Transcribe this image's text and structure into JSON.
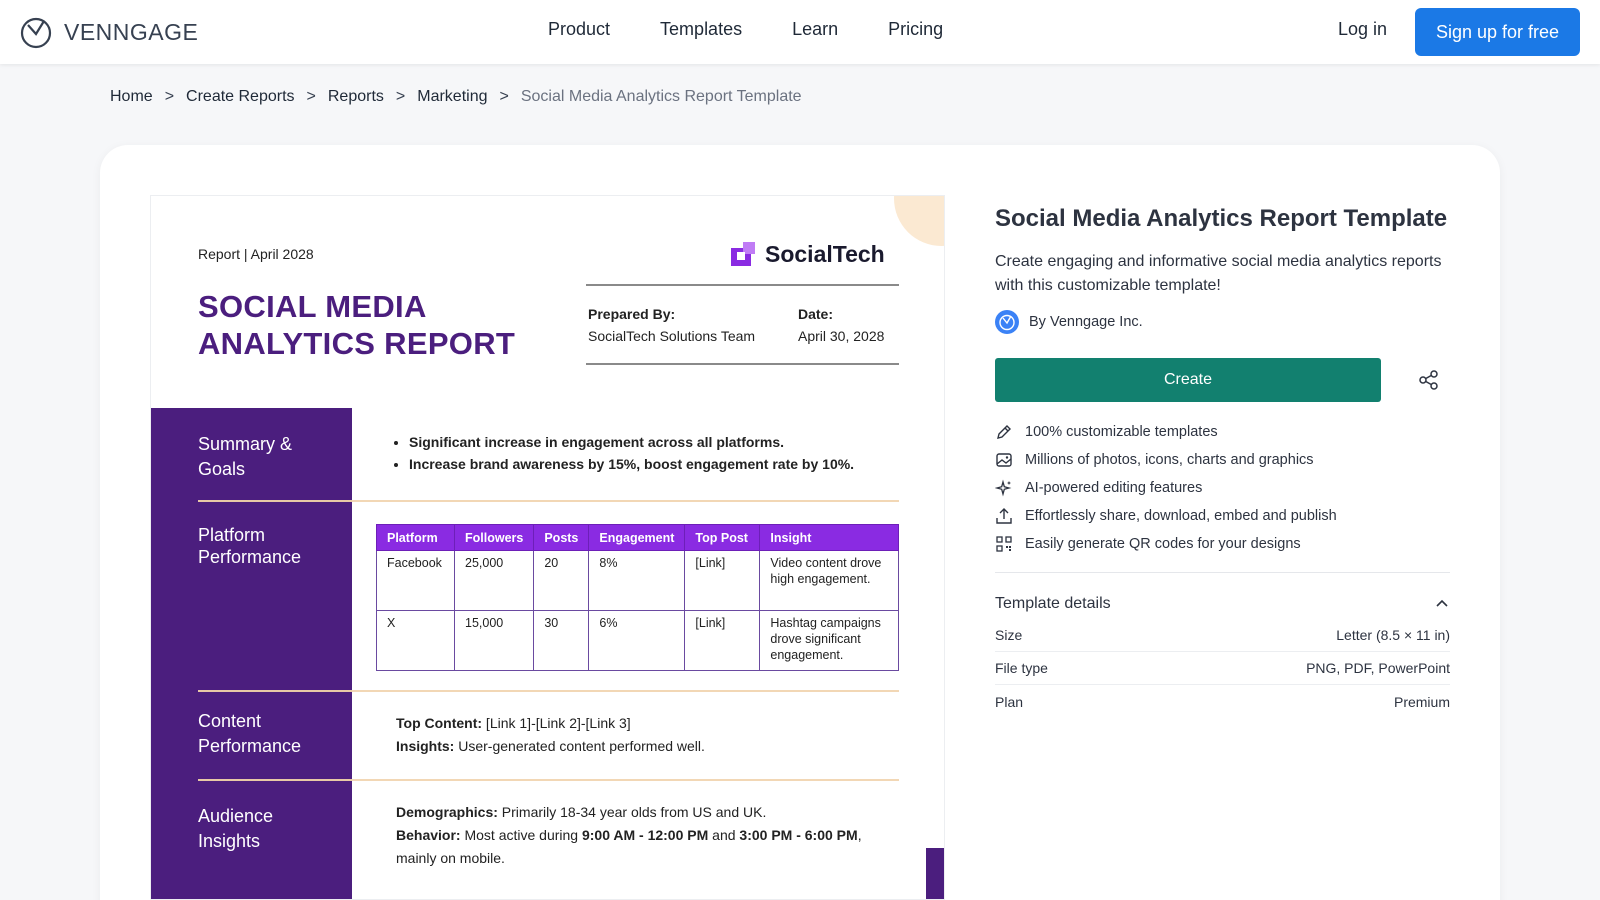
{
  "header": {
    "brand": "VENNGAGE",
    "nav": [
      "Product",
      "Templates",
      "Learn",
      "Pricing"
    ],
    "login": "Log in",
    "signup": "Sign up for free"
  },
  "breadcrumb": [
    "Home",
    "Create Reports",
    "Reports",
    "Marketing"
  ],
  "breadcrumb_sep": ">",
  "breadcrumb_current": "Social Media Analytics Report Template",
  "preview": {
    "topline": "Report | April 2028",
    "brand": "SocialTech",
    "title_line1": "SOCIAL MEDIA",
    "title_line2": "ANALYTICS REPORT",
    "prepared_label": "Prepared By:",
    "prepared_value": "SocialTech Solutions Team",
    "date_label": "Date:",
    "date_value": "April 30, 2028",
    "side": {
      "summary_l1": "Summary &",
      "summary_l2": "Goals",
      "platform_l1": "Platform",
      "platform_l2": "Performance",
      "content_l1": "Content",
      "content_l2": "Performance",
      "audience_l1": "Audience",
      "audience_l2": "Insights"
    },
    "bullets": [
      "Significant increase in engagement across all platforms.",
      "Increase brand awareness by 15%, boost engagement rate by 10%."
    ],
    "table": {
      "headers": [
        "Platform",
        "Followers",
        "Posts",
        "Engagement",
        "Top Post",
        "Insight"
      ],
      "rows": [
        [
          "Facebook",
          "25,000",
          "20",
          "8%",
          "[Link]",
          "Video content drove high engagement."
        ],
        [
          "X",
          "15,000",
          "30",
          "6%",
          "[Link]",
          "Hashtag campaigns drove significant engagement."
        ]
      ]
    },
    "content": {
      "top_label": "Top Content:",
      "top_value": " [Link 1]-[Link 2]-[Link 3]",
      "insights_label": "Insights:",
      "insights_value": " User-generated content performed well."
    },
    "audience": {
      "demo_label": "Demographics:",
      "demo_value": " Primarily 18-34 year olds from US and UK.",
      "behavior_label": "Behavior:",
      "behavior_pre": " Most active during ",
      "behavior_time1": "9:00 AM - 12:00 PM",
      "behavior_and": " and ",
      "behavior_time2": "3:00 PM - 6:00 PM",
      "behavior_post": ", mainly on mobile."
    }
  },
  "info": {
    "title": "Social Media Analytics Report Template",
    "description": "Create engaging and informative social media analytics reports with this customizable template!",
    "author": "By Venngage Inc.",
    "create": "Create",
    "features": [
      {
        "icon": "pencil-icon",
        "text": "100% customizable templates"
      },
      {
        "icon": "image-icon",
        "text": "Millions of photos, icons, charts and graphics"
      },
      {
        "icon": "sparkles-icon",
        "text": "AI-powered editing features"
      },
      {
        "icon": "upload-icon",
        "text": "Effortlessly share, download, embed and publish"
      },
      {
        "icon": "qr-code-icon",
        "text": "Easily generate QR codes for your designs"
      }
    ],
    "details_title": "Template details",
    "details": [
      {
        "label": "Size",
        "value": "Letter (8.5 × 11 in)"
      },
      {
        "label": "File type",
        "value": "PNG, PDF, PowerPoint"
      },
      {
        "label": "Plan",
        "value": "Premium"
      }
    ]
  },
  "colors": {
    "primary_blue": "#1b79e6",
    "create_green": "#12806f",
    "report_purple": "#4b1e7e",
    "table_header": "#8a2be2"
  }
}
